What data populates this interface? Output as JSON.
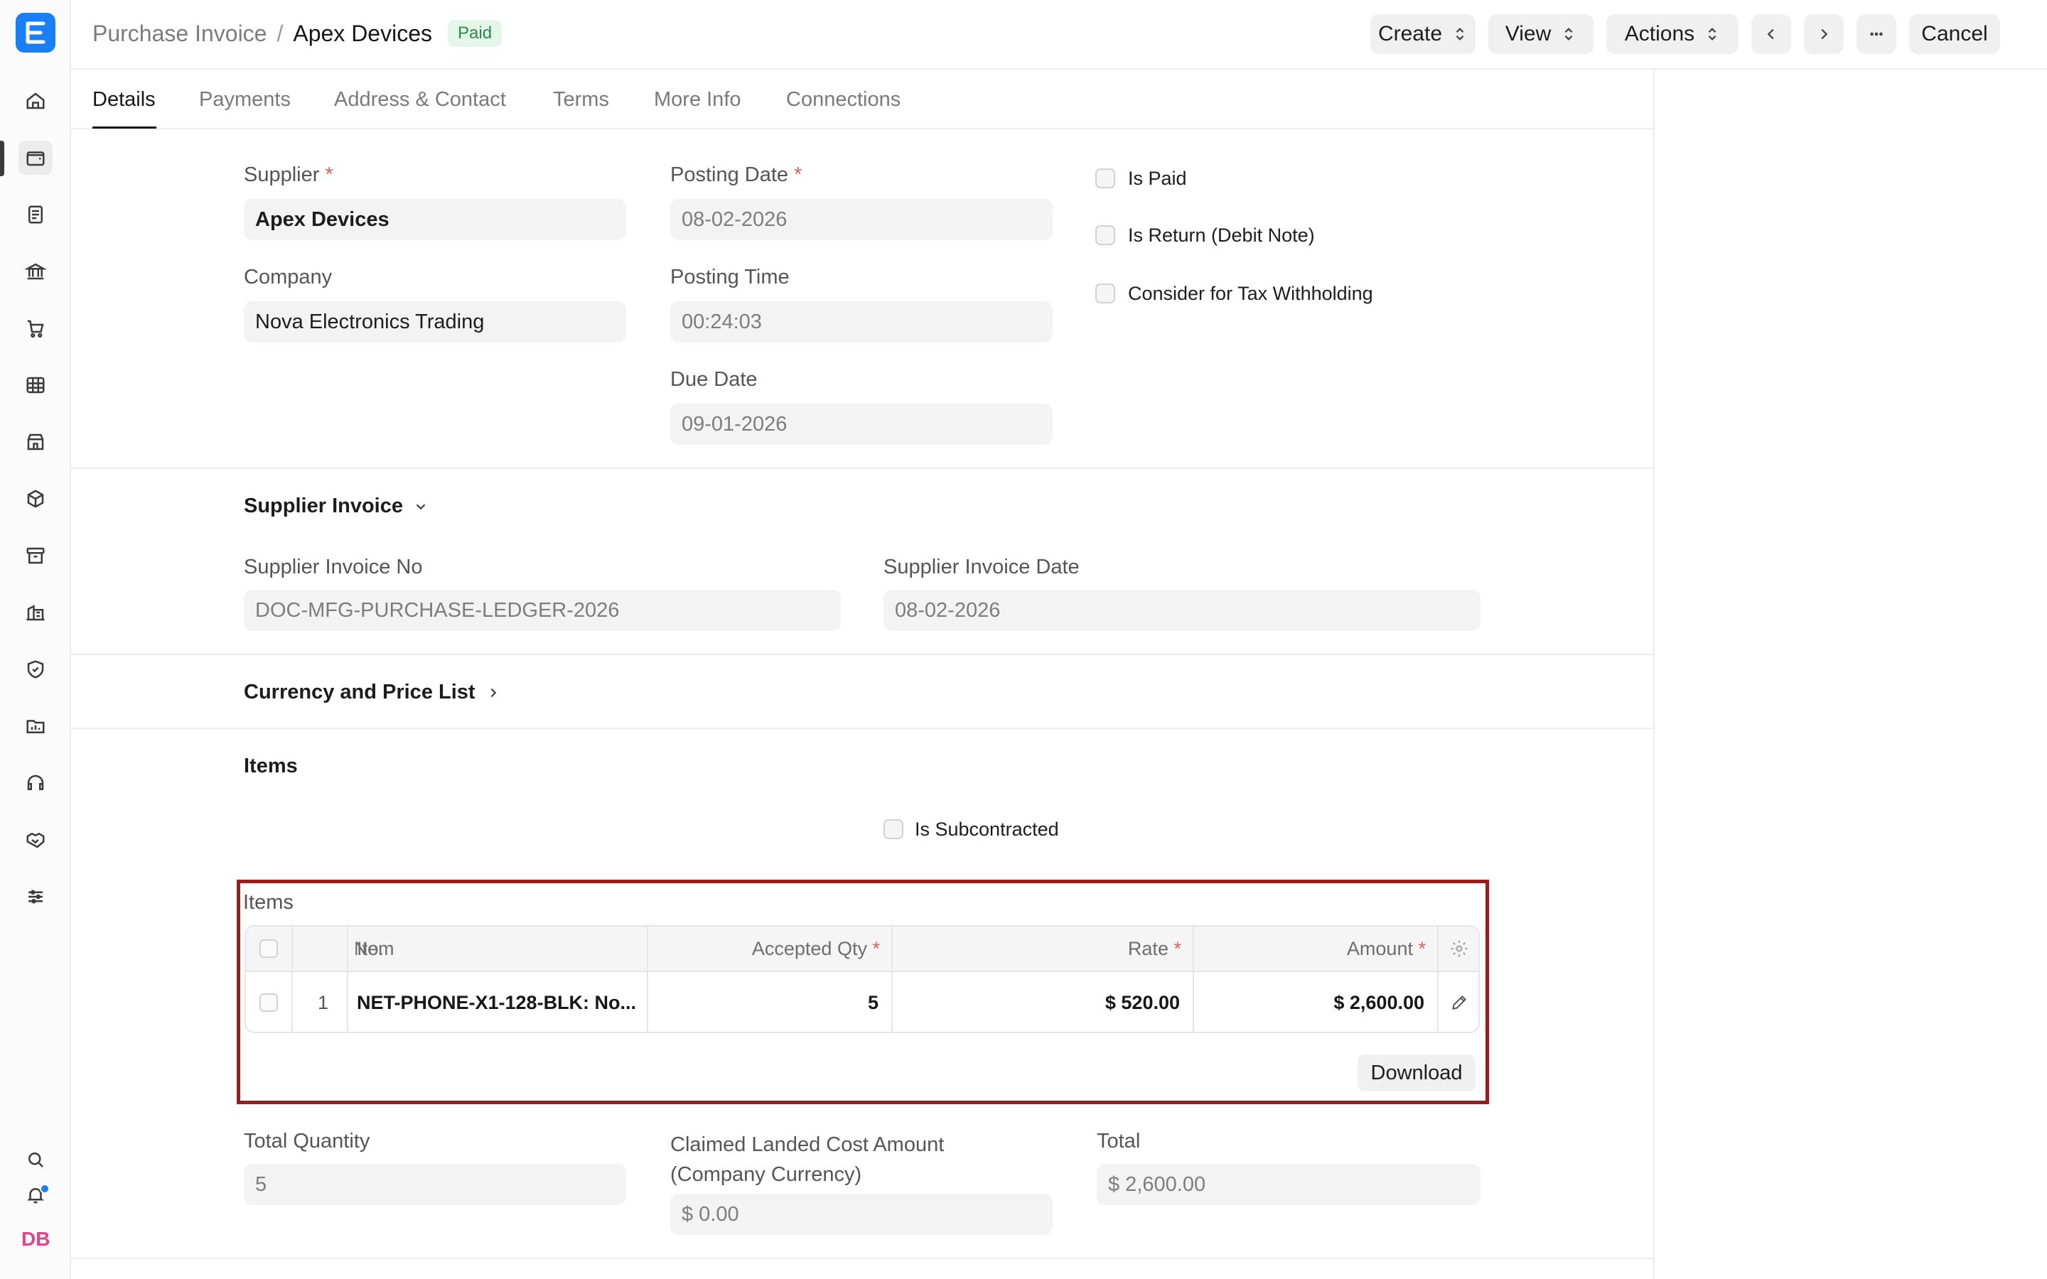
{
  "header": {
    "breadcrumb_parent": "Purchase Invoice",
    "separator": "/",
    "title": "Apex Devices",
    "status": "Paid",
    "create_label": "Create",
    "view_label": "View",
    "actions_label": "Actions",
    "cancel_label": "Cancel"
  },
  "tabs": [
    {
      "label": "Details"
    },
    {
      "label": "Payments"
    },
    {
      "label": "Address & Contact"
    },
    {
      "label": "Terms"
    },
    {
      "label": "More Info"
    },
    {
      "label": "Connections"
    }
  ],
  "form": {
    "supplier_label": "Supplier",
    "supplier_value": "Apex Devices",
    "company_label": "Company",
    "company_value": "Nova Electronics Trading",
    "posting_date_label": "Posting Date",
    "posting_date_value": "08-02-2026",
    "posting_time_label": "Posting Time",
    "posting_time_value": "00:24:03",
    "due_date_label": "Due Date",
    "due_date_value": "09-01-2026",
    "is_paid_label": "Is Paid",
    "is_return_label": "Is Return (Debit Note)",
    "tax_withholding_label": "Consider for Tax Withholding",
    "required_mark": "*"
  },
  "supplier_invoice": {
    "section_title": "Supplier Invoice",
    "no_label": "Supplier Invoice No",
    "no_value": "DOC-MFG-PURCHASE-LEDGER-2026",
    "date_label": "Supplier Invoice Date",
    "date_value": "08-02-2026"
  },
  "currency_section": {
    "title": "Currency and Price List"
  },
  "items_section": {
    "title": "Items",
    "is_subcontracted_label": "Is Subcontracted",
    "table_label": "Items",
    "columns": {
      "no": "No.",
      "item": "Item",
      "qty": "Accepted Qty",
      "rate": "Rate",
      "amount": "Amount"
    },
    "rows": [
      {
        "no": "1",
        "item": "NET-PHONE-X1-128-BLK: No...",
        "qty": "5",
        "rate": "$ 520.00",
        "amount": "$ 2,600.00"
      }
    ],
    "download_label": "Download"
  },
  "totals": {
    "total_qty_label": "Total Quantity",
    "total_qty_value": "5",
    "landed_cost_label_1": "Claimed Landed Cost Amount",
    "landed_cost_label_2": "(Company Currency)",
    "landed_cost_value": "$ 0.00",
    "total_label": "Total",
    "total_value": "$ 2,600.00"
  },
  "user": {
    "initials": "DB"
  }
}
